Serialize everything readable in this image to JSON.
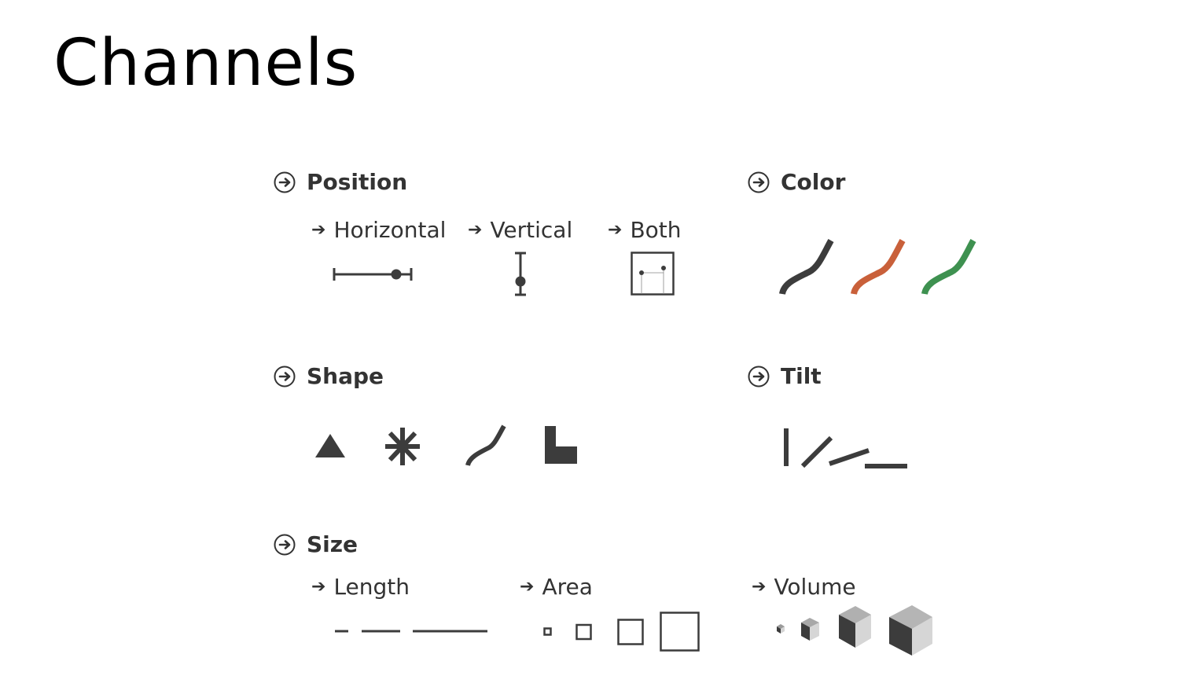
{
  "title": "Channels",
  "sections": {
    "position": {
      "label": "Position",
      "subs": {
        "horizontal": "Horizontal",
        "vertical": "Vertical",
        "both": "Both"
      }
    },
    "color": {
      "label": "Color",
      "colors": [
        "#3c3c3c",
        "#c9603a",
        "#3e9150"
      ]
    },
    "shape": {
      "label": "Shape"
    },
    "tilt": {
      "label": "Tilt"
    },
    "size": {
      "label": "Size",
      "subs": {
        "length": "Length",
        "area": "Area",
        "volume": "Volume"
      }
    }
  },
  "icons": {
    "section_marker": "circle-arrow-icon",
    "sub_marker": "arrow-icon"
  },
  "mark_color": "#3c3c3c"
}
